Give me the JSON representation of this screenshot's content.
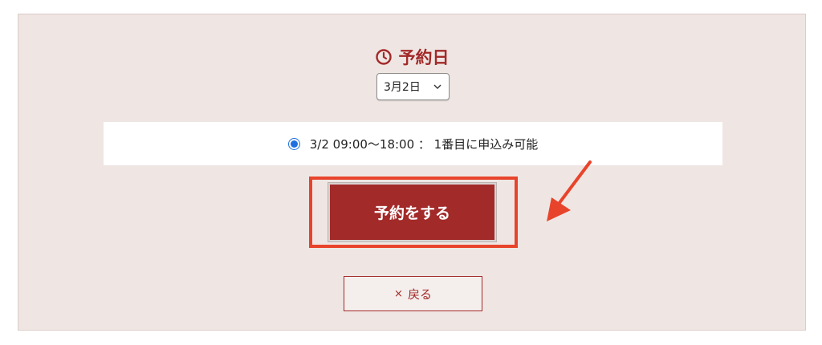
{
  "section": {
    "title": "予約日",
    "title_icon": "clock-icon",
    "accent_color": "#a22a29"
  },
  "date_select": {
    "selected": "3月2日",
    "icon": "chevron-down-icon"
  },
  "slot": {
    "selected": true,
    "label": "3/2 09:00〜18:00 ： 1番目に申込み可能"
  },
  "actions": {
    "reserve_label": "予約をする",
    "back_icon_text": "×",
    "back_label": "戻る"
  },
  "annotation": {
    "highlight_color": "#e8442b",
    "arrow_icon": "arrow-icon"
  }
}
